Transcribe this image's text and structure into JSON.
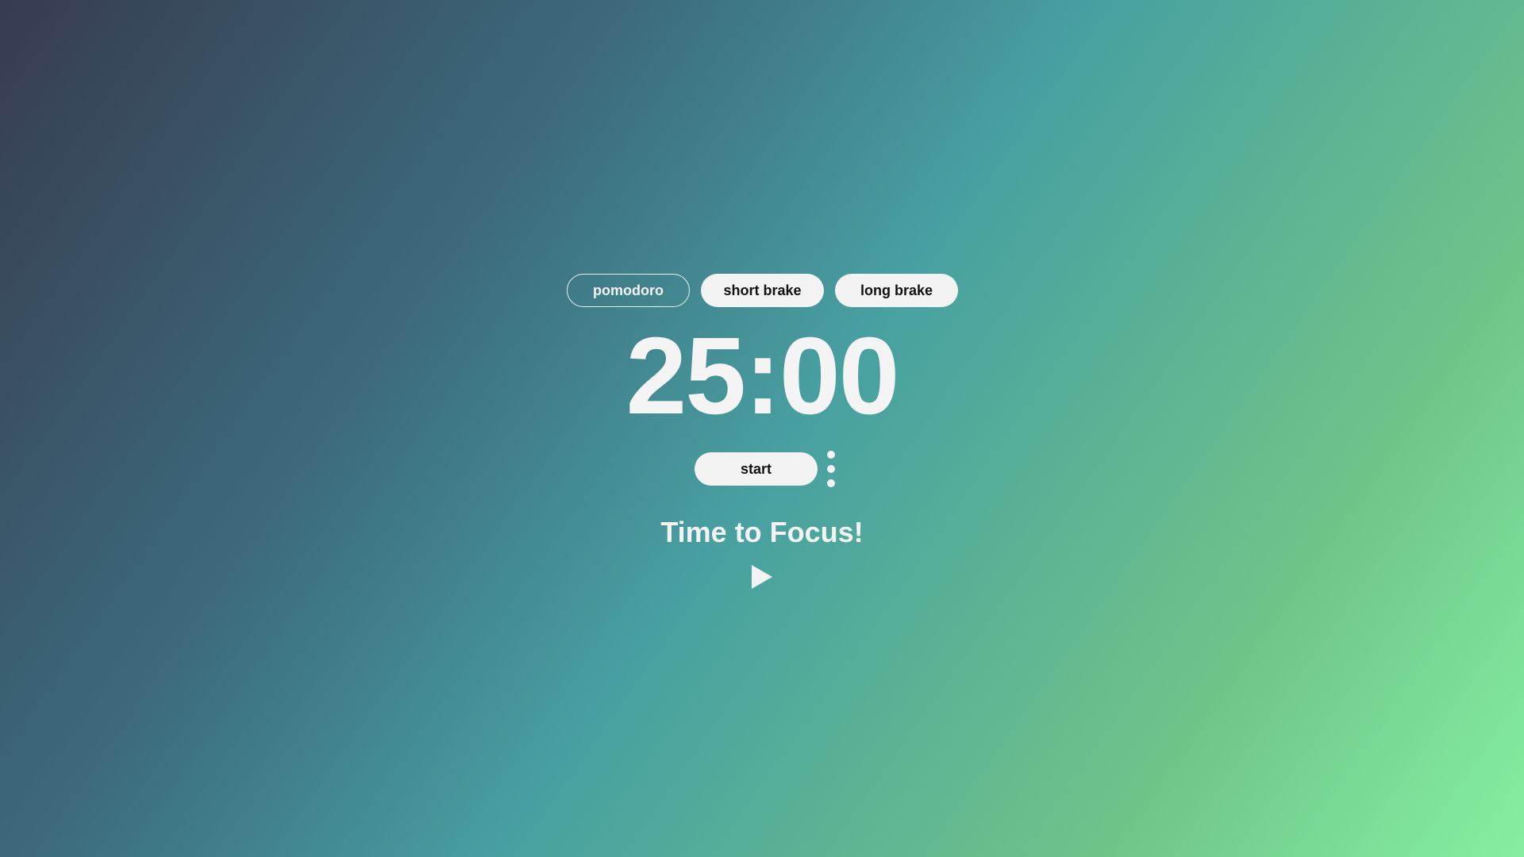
{
  "modes": [
    {
      "label": "pomodoro",
      "active": true
    },
    {
      "label": "short brake",
      "active": false
    },
    {
      "label": "long brake",
      "active": false
    }
  ],
  "timer": {
    "display": "25:00"
  },
  "controls": {
    "start_label": "start",
    "more_icon": "kebab-menu-icon"
  },
  "message": "Time to Focus!",
  "play_icon": "play-icon",
  "colors": {
    "gradient_start": "#373b51",
    "gradient_mid": "#48a0a1",
    "gradient_end": "#86efa2",
    "button_bg": "#f3f3f3",
    "text_light": "#f3f3f3",
    "text_dark": "#111111"
  }
}
